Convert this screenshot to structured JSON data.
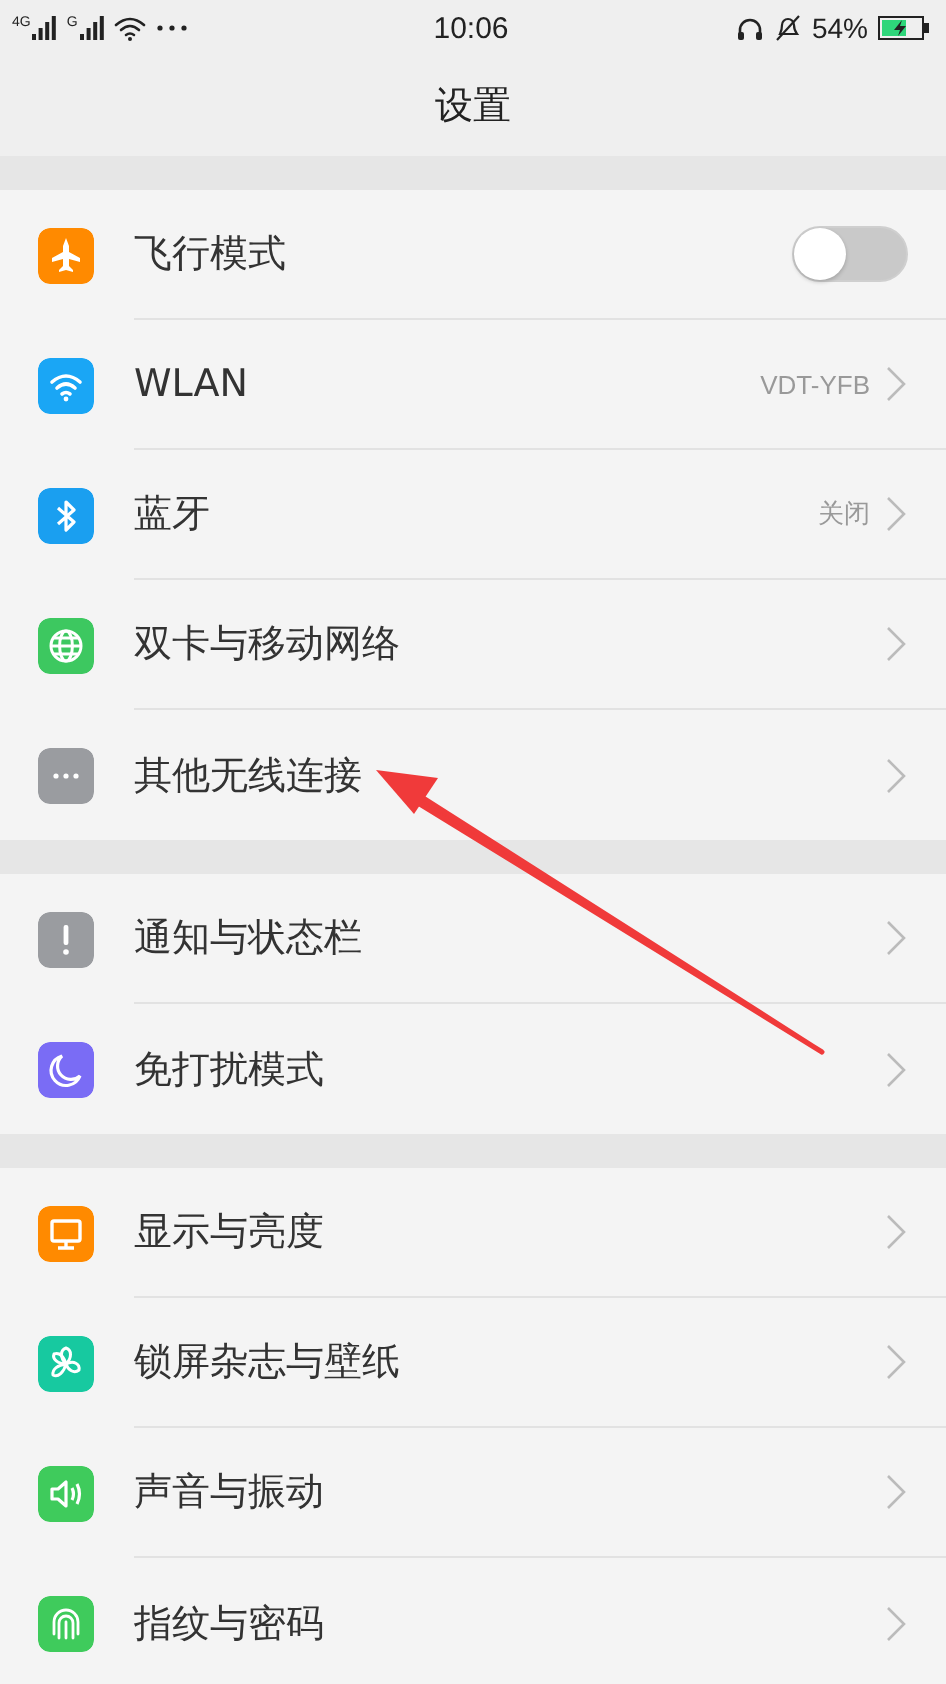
{
  "status_bar": {
    "signal_tags": [
      "4G",
      "G"
    ],
    "time": "10:06",
    "battery": "54%"
  },
  "title": "设置",
  "sections": [
    {
      "items": [
        {
          "kind": "toggle",
          "label": "飞行模式",
          "color": "#ff8a00",
          "on": false
        },
        {
          "kind": "link",
          "label": "WLAN",
          "color": "#1aa6f5",
          "value": "VDT-YFB"
        },
        {
          "kind": "link",
          "label": "蓝牙",
          "color": "#1a9ff0",
          "value": "关闭"
        },
        {
          "kind": "link",
          "label": "双卡与移动网络",
          "color": "#3dc860"
        },
        {
          "kind": "link",
          "label": "其他无线连接",
          "color": "#9a9ca0"
        }
      ]
    },
    {
      "items": [
        {
          "kind": "link",
          "label": "通知与状态栏",
          "color": "#9a9ca0"
        },
        {
          "kind": "link",
          "label": "免打扰模式",
          "color": "#7a6cf5"
        }
      ]
    },
    {
      "items": [
        {
          "kind": "link",
          "label": "显示与亮度",
          "color": "#ff8a00"
        },
        {
          "kind": "link",
          "label": "锁屏杂志与壁纸",
          "color": "#17c9a0"
        },
        {
          "kind": "link",
          "label": "声音与振动",
          "color": "#3fcb5c"
        },
        {
          "kind": "link",
          "label": "指纹与密码",
          "color": "#3fcb5c"
        }
      ]
    }
  ]
}
